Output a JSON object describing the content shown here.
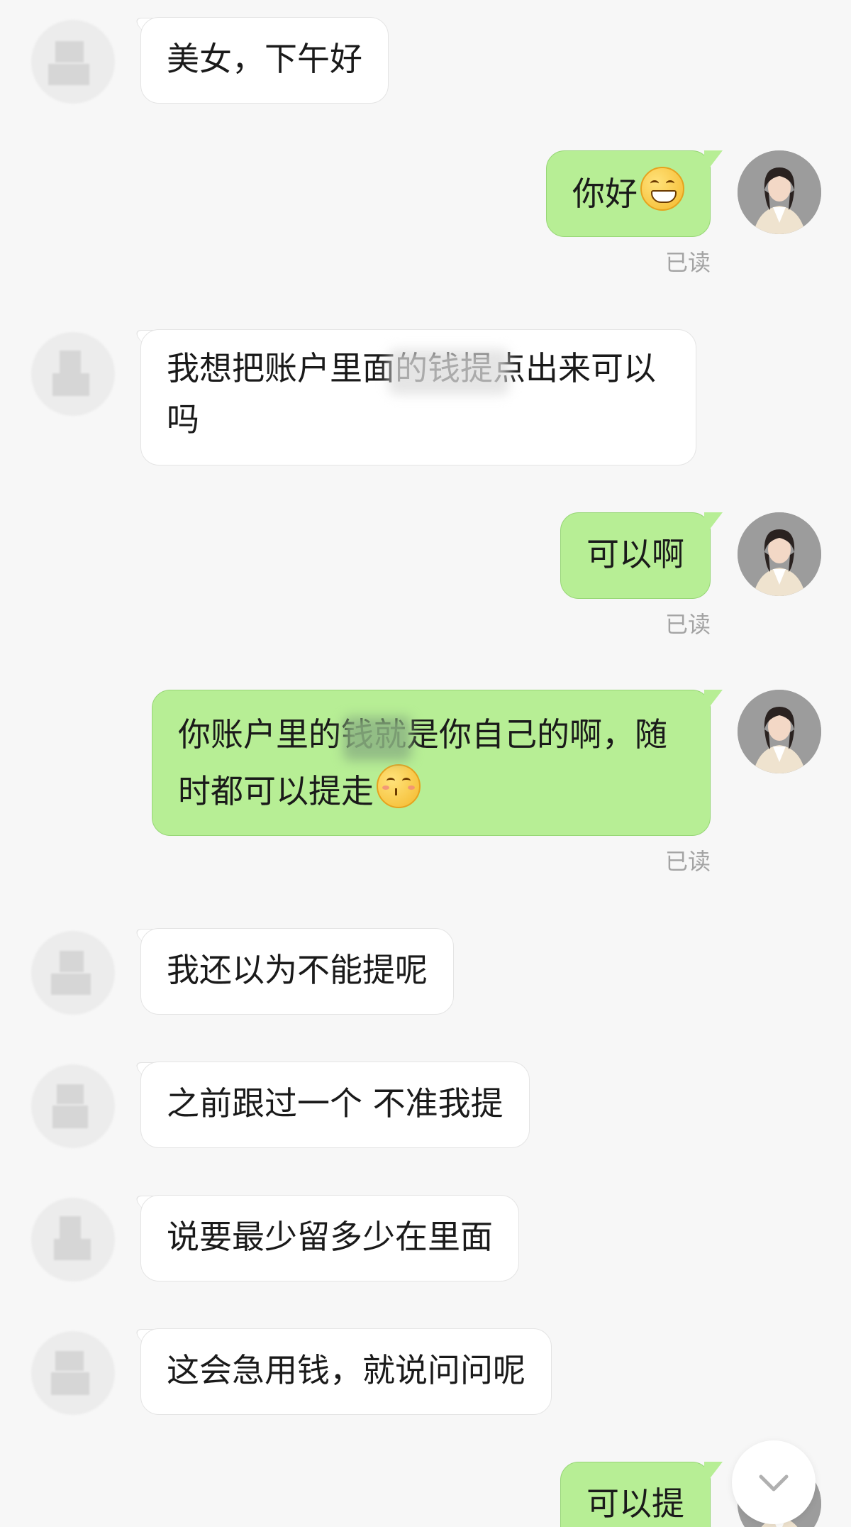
{
  "messages": [
    {
      "side": "them",
      "text": "美女，下午好"
    },
    {
      "side": "me",
      "text": "你好",
      "emoji": "grinning-face",
      "status": "已读"
    },
    {
      "side": "them",
      "text": "我想把账户里面的钱提点出来可以吗"
    },
    {
      "side": "me",
      "text": "可以啊",
      "status": "已读"
    },
    {
      "side": "me",
      "text": "你账户里的钱就是你自己的啊，随时都可以提走",
      "emoji": "kissing-face",
      "status": "已读"
    },
    {
      "side": "them",
      "text": "我还以为不能提呢"
    },
    {
      "side": "them",
      "text": "之前跟过一个 不准我提"
    },
    {
      "side": "them",
      "text": "说要最少留多少在里面"
    },
    {
      "side": "them",
      "text": "这会急用钱，就说问问呢"
    },
    {
      "side": "me",
      "text": "可以提"
    }
  ],
  "icons": {
    "scroll_down": "chevron-down-icon"
  },
  "colors": {
    "background": "#f7f7f7",
    "my_bubble": "#b7ee95",
    "their_bubble": "#ffffff",
    "read_status": "#a4a4a4"
  }
}
